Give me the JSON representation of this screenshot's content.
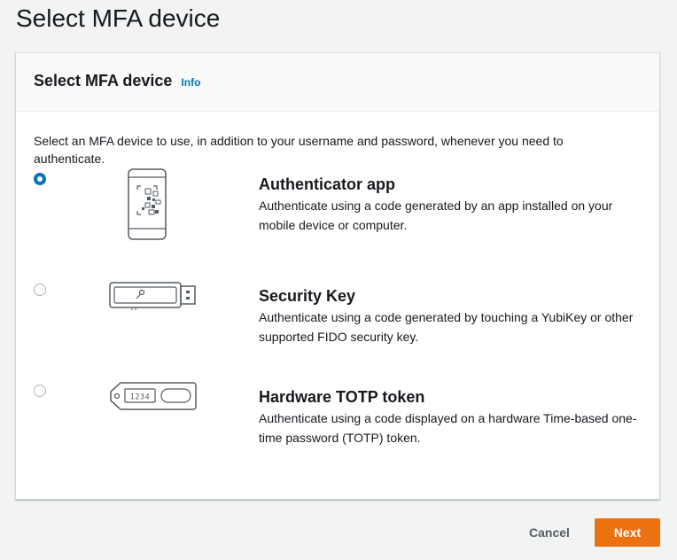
{
  "page": {
    "title": "Select MFA device"
  },
  "panel": {
    "heading": "Select MFA device",
    "info_link": "Info",
    "description": "Select an MFA device to use, in addition to your username and password, whenever you need to authenticate."
  },
  "options": [
    {
      "title": "Authenticator app",
      "description": "Authenticate using a code generated by an app installed on your mobile device or computer.",
      "selected": true,
      "icon": "phone-qr-icon"
    },
    {
      "title": "Security Key",
      "description": "Authenticate using a code generated by touching a YubiKey or other supported FIDO security key.",
      "selected": false,
      "icon": "usb-key-icon"
    },
    {
      "title": "Hardware TOTP token",
      "description": "Authenticate using a code displayed on a hardware Time-based one-time password (TOTP) token.",
      "selected": false,
      "icon": "totp-token-icon",
      "token_display": "1234"
    }
  ],
  "footer": {
    "cancel_label": "Cancel",
    "next_label": "Next"
  },
  "colors": {
    "accent": "#0073bb",
    "primary_button": "#ec7211",
    "background": "#f2f3f3"
  }
}
